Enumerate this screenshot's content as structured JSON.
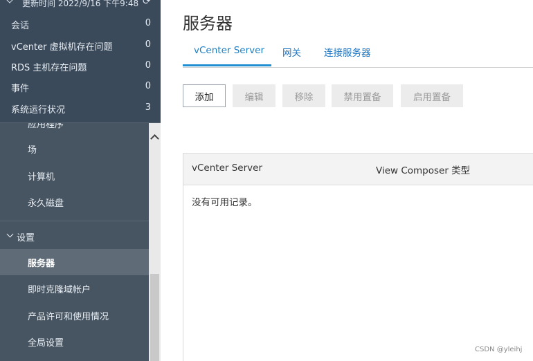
{
  "summary": {
    "header": "更新时间 2022/9/16 下午9:48",
    "rows": [
      {
        "label": "会话",
        "count": "0"
      },
      {
        "label": "vCenter 虚拟机存在问题",
        "count": "0"
      },
      {
        "label": "RDS 主机存在问题",
        "count": "0"
      },
      {
        "label": "事件",
        "count": "0"
      },
      {
        "label": "系统运行状况",
        "count": "3"
      }
    ]
  },
  "nav": {
    "items_top": [
      "应用程序",
      "场",
      "计算机",
      "永久磁盘"
    ],
    "section": "设置",
    "items_settings": [
      "服务器",
      "即时克隆域帐户",
      "产品许可和使用情况",
      "全局设置"
    ]
  },
  "main": {
    "title": "服务器",
    "tabs": [
      "vCenter Server",
      "网关",
      "连接服务器"
    ],
    "buttons": [
      "添加",
      "编辑",
      "移除",
      "禁用置备",
      "启用置备"
    ],
    "columns": [
      "vCenter Server",
      "View Composer 类型"
    ],
    "empty_text": "没有可用记录。"
  },
  "watermark": "CSDN @yleihj"
}
